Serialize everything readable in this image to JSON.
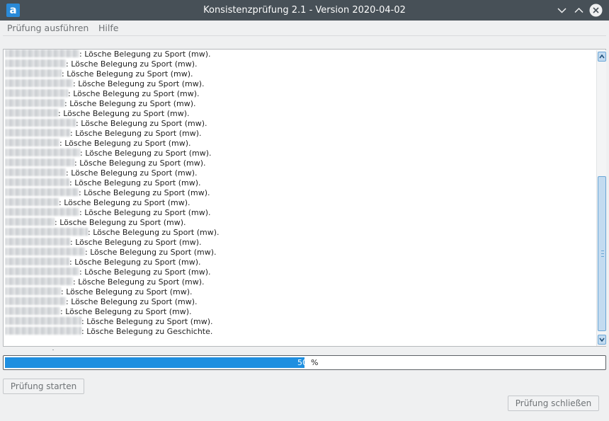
{
  "window": {
    "title": "Konsistenzprüfung 2.1 - Version 2020-04-02",
    "icon_letter": "a",
    "controls": [
      "minimize-icon",
      "maximize-icon",
      "close-icon"
    ]
  },
  "menubar": {
    "items": [
      "Prüfung ausführen",
      "Hilfe"
    ]
  },
  "log": {
    "lines": [
      {
        "name_width": 105,
        "message": ": Lösche Belegung zu Sport (mw)."
      },
      {
        "name_width": 86,
        "message": ": Lösche Belegung zu Sport (mw)."
      },
      {
        "name_width": 80,
        "message": ": Lösche Belegung zu Sport (mw)."
      },
      {
        "name_width": 96,
        "message": ": Lösche Belegung zu Sport (mw)."
      },
      {
        "name_width": 89,
        "message": ": Lösche Belegung zu Sport (mw)."
      },
      {
        "name_width": 84,
        "message": ": Lösche Belegung zu Sport (mw)."
      },
      {
        "name_width": 75,
        "message": ": Lösche Belegung zu Sport (mw)."
      },
      {
        "name_width": 100,
        "message": ": Lösche Belegung zu Sport (mw)."
      },
      {
        "name_width": 92,
        "message": ": Lösche Belegung zu Sport (mw)."
      },
      {
        "name_width": 77,
        "message": ": Lösche Belegung zu Sport (mw)."
      },
      {
        "name_width": 106,
        "message": ": Lösche Belegung zu Sport (mw)."
      },
      {
        "name_width": 98,
        "message": ": Lösche Belegung zu Sport (mw)."
      },
      {
        "name_width": 86,
        "message": ": Lösche Belegung zu Sport (mw)."
      },
      {
        "name_width": 91,
        "message": ": Lösche Belegung zu Sport (mw)."
      },
      {
        "name_width": 104,
        "message": ": Lösche Belegung zu Sport (mw)."
      },
      {
        "name_width": 76,
        "message": ": Lösche Belegung zu Sport (mw)."
      },
      {
        "name_width": 105,
        "message": ": Lösche Belegung zu Sport (mw)."
      },
      {
        "name_width": 70,
        "message": ": Lösche Belegung zu Sport (mw)."
      },
      {
        "name_width": 117,
        "message": ": Lösche Belegung zu Sport (mw)."
      },
      {
        "name_width": 92,
        "message": ": Lösche Belegung zu Sport (mw)."
      },
      {
        "name_width": 113,
        "message": ": Lösche Belegung zu Sport (mw)."
      },
      {
        "name_width": 91,
        "message": ": Lösche Belegung zu Sport (mw)."
      },
      {
        "name_width": 105,
        "message": ": Lösche Belegung zu Sport (mw)."
      },
      {
        "name_width": 96,
        "message": ": Lösche Belegung zu Sport (mw)."
      },
      {
        "name_width": 79,
        "message": ": Lösche Belegung zu Sport (mw)."
      },
      {
        "name_width": 86,
        "message": ": Lösche Belegung zu Sport (mw)."
      },
      {
        "name_width": 78,
        "message": ": Lösche Belegung zu Sport (mw)."
      },
      {
        "name_width": 108,
        "message": ": Lösche Belegung zu Sport (mw)."
      },
      {
        "name_width": 108,
        "message": ": Lösche Belegung zu Geschichte."
      }
    ]
  },
  "progress": {
    "value": 50,
    "display_number": "50",
    "unit": "%",
    "fill_color": "#1f8fe0"
  },
  "buttons": {
    "start_label": "Prüfung starten",
    "close_label": "Prüfung schließen"
  }
}
